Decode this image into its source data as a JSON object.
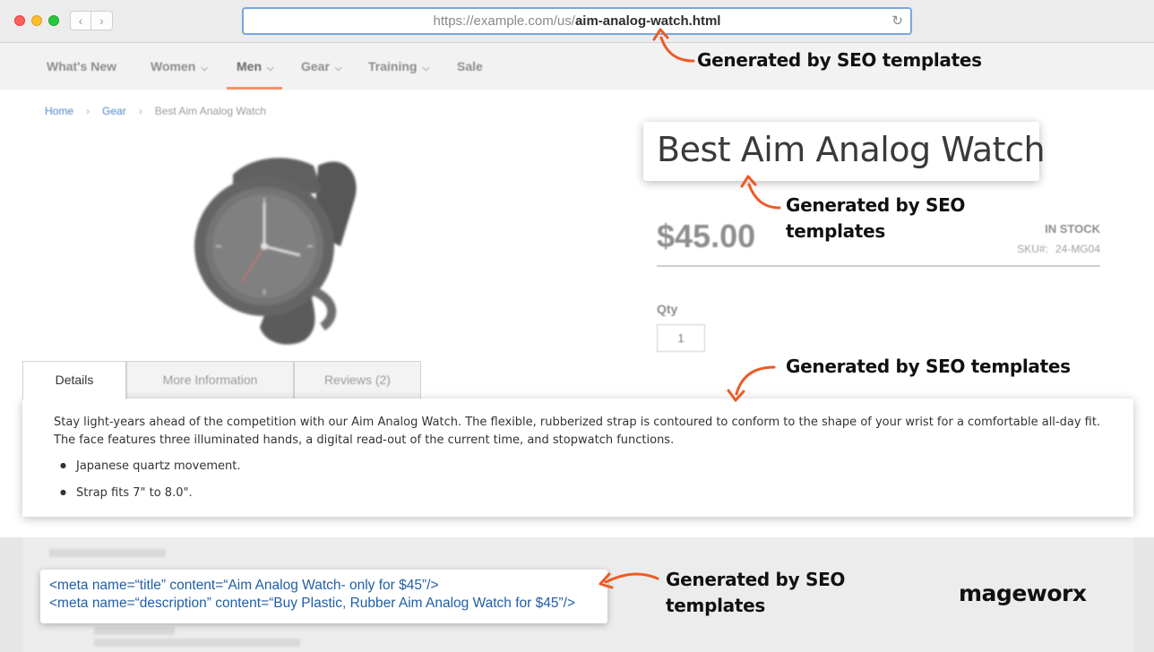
{
  "browser": {
    "url_prefix": "https://example.com/us/",
    "url_slug": "aim-analog-watch.html",
    "back_glyph": "‹",
    "forward_glyph": "›",
    "reload_glyph": "↻"
  },
  "nav": {
    "items": [
      {
        "label": "What's New",
        "has_menu": false
      },
      {
        "label": "Women",
        "has_menu": true
      },
      {
        "label": "Men",
        "has_menu": true
      },
      {
        "label": "Gear",
        "has_menu": true
      },
      {
        "label": "Training",
        "has_menu": true
      },
      {
        "label": "Sale",
        "has_menu": false
      }
    ],
    "active": "Men",
    "active_color": "#ff6f3a",
    "chevron": "⌵"
  },
  "breadcrumb": [
    "Home",
    "Gear",
    "Best Aim Analog Watch"
  ],
  "breadcrumb_separator": "›",
  "product": {
    "title": "Best Aim Analog Watch",
    "price": "$45.00",
    "stock": "IN STOCK",
    "sku_label": "SKU#:",
    "sku": "24-MG04",
    "qty_label": "Qty",
    "qty_value": "1"
  },
  "tabs": [
    {
      "label": "Details",
      "active": true
    },
    {
      "label": "More Information",
      "active": false
    },
    {
      "label": "Reviews (2)",
      "active": false
    }
  ],
  "details": {
    "text": "Stay light-years ahead of the competition with our Aim Analog Watch. The flexible, rubberized strap is contoured to conform to the shape of your wrist for a comfortable all-day fit. The face features three illuminated hands, a digital read-out of the current time, and stopwatch functions.",
    "bullets": [
      "Japanese quartz movement.",
      "Strap fits 7\" to 8.0\"."
    ]
  },
  "meta": {
    "title_line": "<meta name=“title” content=“Aim Analog Watch- only for $45”/>",
    "description_line": "<meta name=“description” content=“Buy Plastic, Rubber Aim Analog Watch for $45”/>"
  },
  "annotations": {
    "url": "Generated by SEO templates",
    "title_line1": "Generated by SEO",
    "title_line2": "templates",
    "details": "Generated by SEO templates",
    "meta_line1": "Generated by SEO",
    "meta_line2": "templates",
    "arrow_color": "#ee5a24"
  },
  "brand": {
    "logo": "mageworx"
  }
}
